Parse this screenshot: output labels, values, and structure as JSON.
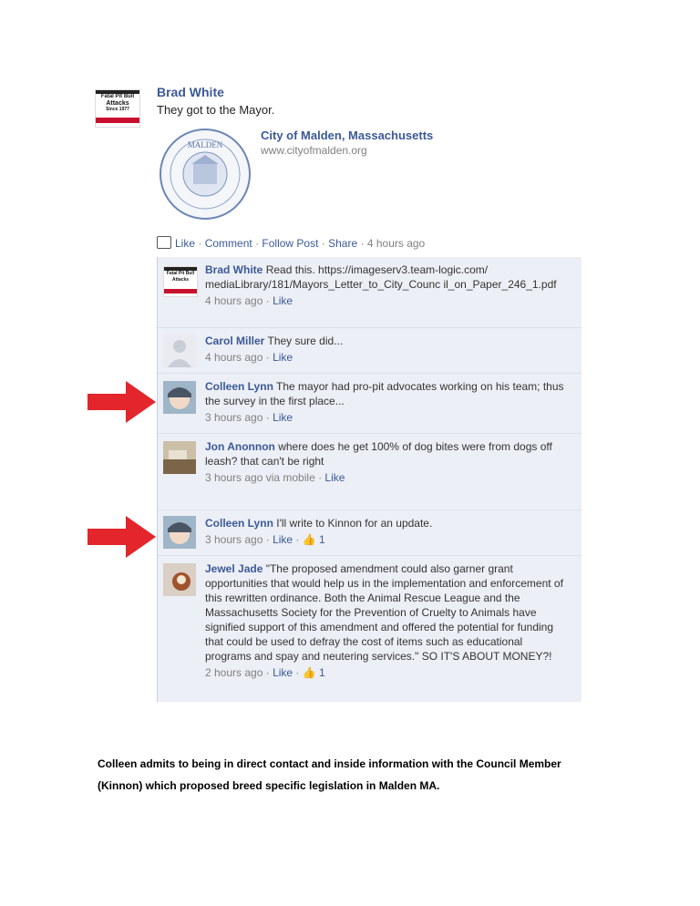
{
  "post": {
    "author": "Brad White",
    "text": "They got to the Mayor.",
    "avatar_text": [
      "Fatal Pit Bull",
      "Attacks",
      "Since 1977"
    ],
    "share": {
      "title": "City of Malden, Massachusetts",
      "url": "www.cityofmalden.org",
      "seal_text": "MALDEN"
    },
    "actions": {
      "like": "Like",
      "comment": "Comment",
      "follow": "Follow Post",
      "share": "Share",
      "time": "4 hours ago",
      "sep": "·"
    }
  },
  "comments": [
    {
      "author": "Brad White",
      "text": "Read this. https://imageserv3.team-logic.com/ mediaLibrary/181/Mayors_Letter_to_City_Counc il_on_Paper_246_1.pdf",
      "time": "4 hours ago",
      "like": "Like"
    },
    {
      "author": "Carol Miller",
      "text": "They sure did...",
      "time": "4 hours ago",
      "like": "Like"
    },
    {
      "author": "Colleen Lynn",
      "text": "The mayor had pro-pit advocates working on his team; thus the survey in the first place...",
      "time": "3 hours ago",
      "like": "Like"
    },
    {
      "author": "Jon Anonnon",
      "text": "where does he get 100% of dog bites were from dogs off leash? that can't be right",
      "time": "3 hours ago via mobile",
      "like": "Like"
    },
    {
      "author": "Colleen Lynn",
      "text": "I'll write to Kinnon for an update.",
      "time": "3 hours ago",
      "like": "Like",
      "likes": "1"
    },
    {
      "author": "Jewel Jade",
      "text": "\"The proposed amendment could also garner grant opportunities that would help us in the implementation and enforcement of this rewritten ordinance. Both the Animal Rescue League and the Massachusetts Society for the Prevention of Cruelty to Animals have signified support of this amendment and offered the potential for funding that could be used to defray the cost of items such as educational programs and spay and neutering services.\" SO IT'S ABOUT MONEY?!",
      "time": "2 hours ago",
      "like": "Like",
      "likes": "1"
    }
  ],
  "footer": "Colleen admits to being in direct contact and inside information with the Council Member (Kinnon) which proposed breed specific legislation in Malden MA.",
  "colors": {
    "link": "#3b5998",
    "arrow": "#e3262b",
    "comment_bg": "#eceff5"
  }
}
